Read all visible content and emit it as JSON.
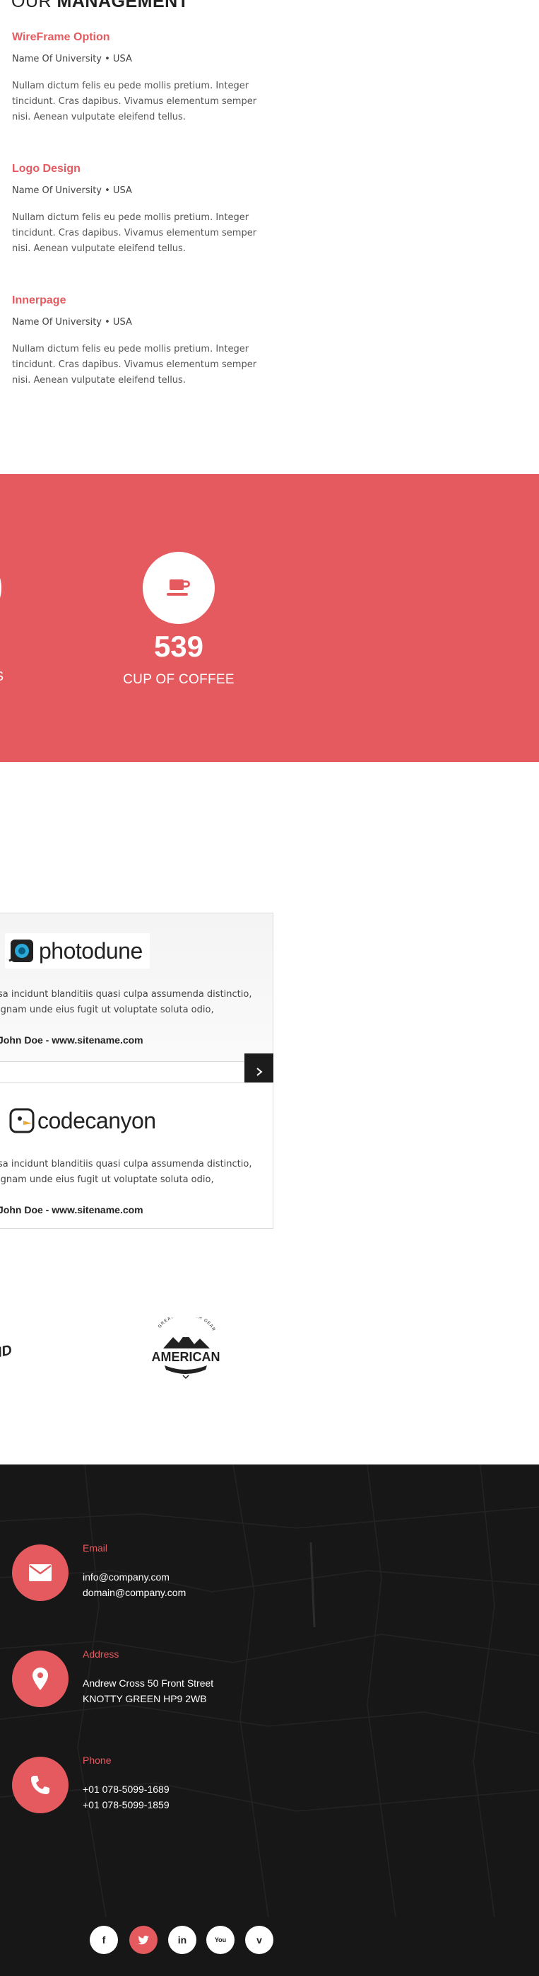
{
  "management": {
    "title_light": "OUR",
    "title_bold": "MANAGEMENT",
    "entries": [
      {
        "title": "WireFrame Option",
        "subtitle": "Name Of University • USA",
        "text": "Nullam dictum felis eu pede mollis pretium. Integer tincidunt. Cras dapibus. Vivamus elementum semper nisi. Aenean vulputate eleifend tellus."
      },
      {
        "title": "Logo Design",
        "subtitle": "Name Of University • USA",
        "text": "Nullam dictum felis eu pede mollis pretium. Integer tincidunt. Cras dapibus. Vivamus elementum semper nisi. Aenean vulputate eleifend tellus."
      },
      {
        "title": "Innerpage",
        "subtitle": "Name Of University • USA",
        "text": "Nullam dictum felis eu pede mollis pretium. Integer tincidunt. Cras dapibus. Vivamus elementum semper nisi. Aenean vulputate eleifend tellus."
      }
    ]
  },
  "counters": {
    "partial_label": "DS",
    "coffee_value": "539",
    "coffee_label": "CUP OF COFFEE",
    "icon": "coffee-cup-icon"
  },
  "testimonials": [
    {
      "logo": "photodune",
      "text": "sa incidunt blanditiis quasi culpa assumenda distinctio, ignam unde eius fugit ut voluptate soluta odio,",
      "author": "John Doe - www.sitename.com"
    },
    {
      "logo": "codecanyon",
      "text": "sa incidunt blanditiis quasi culpa assumenda distinctio, ignam unde eius fugit ut voluptate soluta odio,",
      "author": "John Doe - www.sitename.com"
    }
  ],
  "clients": {
    "partial_text": "ND",
    "american_top": "GREAT OUTDOOR GEAR",
    "american": "AMERICAN"
  },
  "footer": {
    "email": {
      "label": "Email",
      "line1": "info@company.com",
      "line2": "domain@company.com"
    },
    "address": {
      "label": "Address",
      "line1": "Andrew Cross 50 Front Street",
      "line2": "KNOTTY GREEN HP9 2WB"
    },
    "phone": {
      "label": "Phone",
      "line1": "+01 078-5099-1689",
      "line2": "+01 078-5099-1859"
    },
    "social": [
      {
        "name": "facebook",
        "glyph": "f"
      },
      {
        "name": "twitter",
        "glyph": "t"
      },
      {
        "name": "linkedin",
        "glyph": "in"
      },
      {
        "name": "youtube",
        "glyph": "You"
      },
      {
        "name": "vimeo",
        "glyph": "v"
      }
    ]
  },
  "colors": {
    "accent": "#e55a5f",
    "dark": "#171717",
    "button_dark": "#1c1c1c"
  }
}
